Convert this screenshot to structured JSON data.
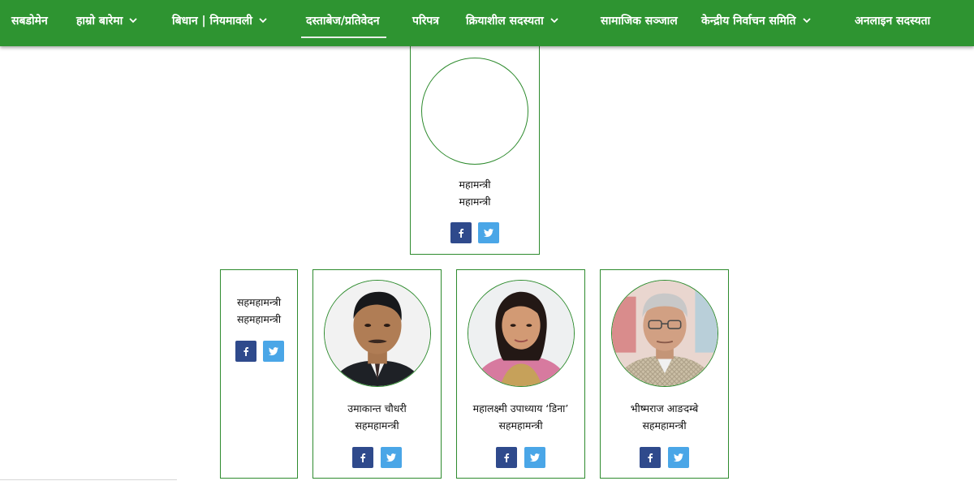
{
  "nav": {
    "items": [
      {
        "label": "सबडोमेन",
        "dropdown": false
      },
      {
        "label": "हाम्रो बारेमा",
        "dropdown": true
      },
      {
        "label": "बिधान | नियमावली",
        "dropdown": true
      },
      {
        "label": "दस्ताबेज/प्रतिवेदन",
        "dropdown": false,
        "active": true
      },
      {
        "label": "परिपत्र",
        "dropdown": false
      },
      {
        "label": "क्रियाशील सदस्यता",
        "dropdown": true
      },
      {
        "label": "सामाजिक सञ्जाल",
        "dropdown": false
      },
      {
        "label": "केन्द्रीय निर्वाचन समिति",
        "dropdown": true
      },
      {
        "label": "अनलाइन सदस्यता",
        "dropdown": false
      }
    ]
  },
  "general_secretary": {
    "name": "महामन्त्री",
    "role": "महामन्त्री"
  },
  "members": [
    {
      "name": "सहमहामन्त्री",
      "role": "सहमहामन्त्री",
      "photo": "none"
    },
    {
      "name": "उमाकान्त चौधरी",
      "role": "सहमहामन्त्री",
      "photo": "man-dark-suit"
    },
    {
      "name": "महालक्ष्मी उपाध्याय ‘डिना’",
      "role": "सहमहामन्त्री",
      "photo": "woman-pink-saree"
    },
    {
      "name": "भीष्मराज आङदम्बे",
      "role": "सहमहामन्त्री",
      "photo": "man-glasses-traditional-coat"
    }
  ],
  "colors": {
    "nav_bg": "#2e9431",
    "border": "#2e8b2e",
    "facebook": "#2f4a8c",
    "twitter": "#4aa6e7"
  },
  "icons": {
    "facebook": "facebook-icon",
    "twitter": "twitter-icon",
    "dropdown": "chevron-down-icon"
  }
}
